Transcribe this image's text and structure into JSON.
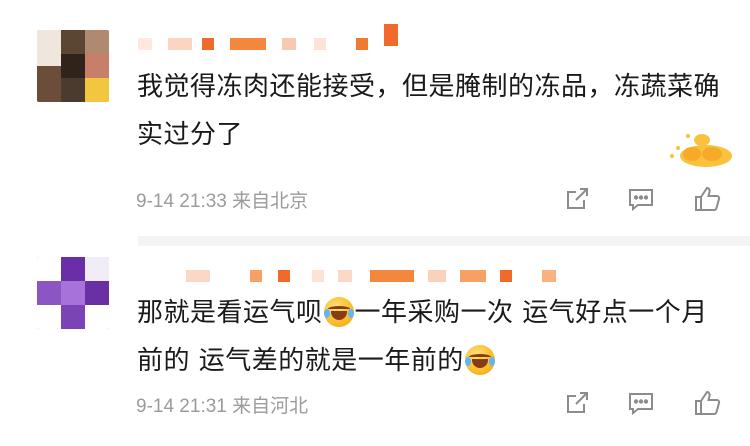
{
  "comments": [
    {
      "text": "我觉得冻肉还能接受，但是腌制的冻品，冻蔬菜确实过分了",
      "time": "9-14 21:33",
      "location": "来自北京"
    },
    {
      "text_a": "那就是看运气呗",
      "text_b": "一年采购一次 运气好点一个月前的 运气差的就是一年前的",
      "time": "9-14 21:31",
      "location": "来自河北"
    }
  ],
  "icons": {
    "share": "share-icon",
    "comment": "comment-icon",
    "like": "thumbs-up-icon",
    "emoji": "laugh-cry-emoji-icon"
  },
  "colors": {
    "text": "#1a1a1a",
    "meta": "#9b9b9b",
    "icon": "#8c8c8c",
    "username_blur": "#f08a3c"
  }
}
